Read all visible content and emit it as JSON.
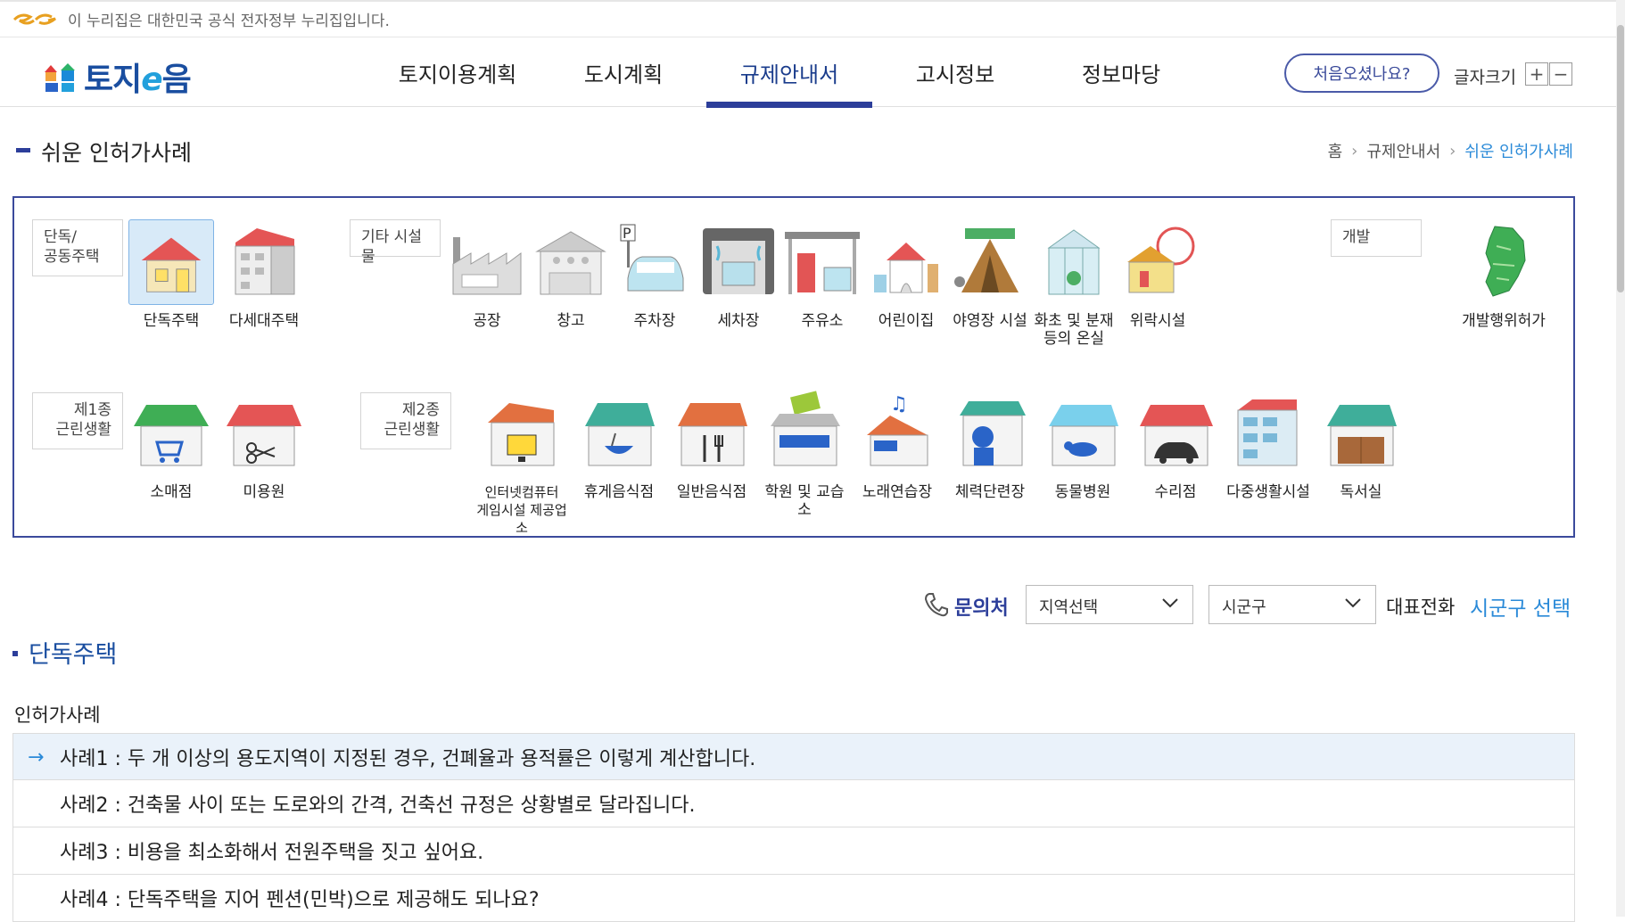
{
  "gov_banner": {
    "text": "이 누리집은 대한민국 공식 전자정부 누리집입니다."
  },
  "logo": {
    "text_main": "토지",
    "text_e": "e",
    "text_end": "음"
  },
  "nav": [
    "토지이용계획",
    "도시계획",
    "규제안내서",
    "고시정보",
    "정보마당"
  ],
  "nav_active_index": 2,
  "header": {
    "first_visit": "처음오셨나요?",
    "font_size_label": "글자크기",
    "plus": "+",
    "minus": "−"
  },
  "page": {
    "title": "쉬운 인허가사례"
  },
  "breadcrumb": [
    "홈",
    "규제안내서",
    "쉬운 인허가사례"
  ],
  "categories": {
    "housing": {
      "label": "단독/\n공동주택",
      "items": [
        "단독주택",
        "다세대주택"
      ]
    },
    "other": {
      "label": "기타 시설물",
      "items": [
        "공장",
        "창고",
        "주차장",
        "세차장",
        "주유소",
        "어린이집",
        "야영장 시설",
        "화초 및 분재\n등의 온실",
        "위락시설"
      ]
    },
    "dev": {
      "label": "개발",
      "items": [
        "개발행위허가"
      ]
    },
    "first": {
      "label": "제1종\n근린생활",
      "items": [
        "소매점",
        "미용원"
      ]
    },
    "second": {
      "label": "제2종\n근린생활",
      "items": [
        "인터넷컴퓨터\n게임시설 제공업소",
        "휴게음식점",
        "일반음식점",
        "학원 및 교습소",
        "노래연습장",
        "체력단련장",
        "동물병원",
        "수리점",
        "다중생활시설",
        "독서실"
      ]
    }
  },
  "contact": {
    "label": "문의처",
    "region_select": "지역선택",
    "district_select": "시군구",
    "rep_label": "대표전화",
    "rep_value": "시군구 선택"
  },
  "section": {
    "title": "단독주택",
    "subtitle": "인허가사례"
  },
  "cases": [
    "사례1 : 두 개 이상의 용도지역이 지정된 경우, 건폐율과 용적률은 이렇게 계산합니다.",
    "사례2 : 건축물 사이 또는 도로와의 간격, 건축선 규정은 상황별로 달라집니다.",
    "사례3 : 비용을 최소화해서 전원주택을 짓고 싶어요.",
    "사례4 : 단독주택을 지어 펜션(민박)으로 제공해도 되나요?"
  ],
  "colors": {
    "accent": "#2c3e9a",
    "link": "#2a8ad8",
    "active_row": "#eaf2fa"
  }
}
